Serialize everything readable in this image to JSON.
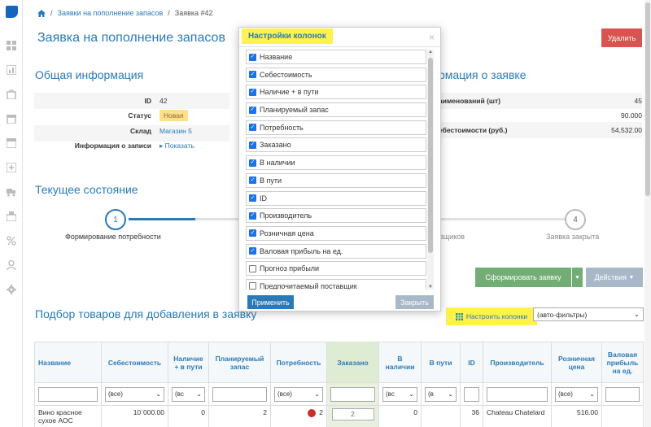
{
  "breadcrumb": {
    "items": [
      "Заявки на пополнение запасов",
      "Заявка #42"
    ]
  },
  "page_title": "Заявка на пополнение запасов",
  "delete_button": "Удалить",
  "general_info": {
    "title": "Общая информация",
    "rows": [
      {
        "label": "ID",
        "value": "42"
      },
      {
        "label": "Статус",
        "value": "Новая"
      },
      {
        "label": "Склад",
        "value": "Магазин 5"
      },
      {
        "label": "Информация о записи",
        "value": "Показать"
      }
    ]
  },
  "order_info": {
    "title": "рмация о заявке",
    "rows": [
      {
        "label": "аименований (шт)",
        "value": "45"
      },
      {
        "label": "",
        "value": "90.000"
      },
      {
        "label": "ебестоимости (руб.)",
        "value": "54,532.00"
      }
    ]
  },
  "current_state": {
    "title": "Текущее состояние",
    "steps": [
      {
        "num": "1",
        "label": "Формирование потребности"
      },
      {
        "num": "4",
        "label": "Заявка закрыта"
      }
    ],
    "partial_label": "вщиков"
  },
  "actions": {
    "form_order": "Сформировать заявку",
    "actions": "Действия"
  },
  "selection": {
    "title": "Подбор товаров для добавления в заявку",
    "configure_columns": "Настроить колонки",
    "filter_select": "(авто-фильтры)"
  },
  "table": {
    "headers": [
      "Название",
      "Себестоимость",
      "Наличие + в пути",
      "Планируемый запас",
      "Потребность",
      "Заказано",
      "В наличии",
      "В пути",
      "ID",
      "Производитель",
      "Розничная цена",
      "Валовая прибыль на ед."
    ],
    "filters": {
      "all_1": "(все)",
      "all_2": "(вс",
      "all_3": "(вс",
      "all_4": "(все)",
      "all_5": "(вс",
      "all_6": "(в",
      "all_7": "(все)"
    },
    "row": {
      "name": "Вино красное сухое АОС",
      "cost": "10`000.00",
      "stock_transit": "0",
      "planned": "2",
      "need": "2",
      "ordered": "2",
      "in_stock": "0",
      "in_transit": "",
      "id": "36",
      "manufacturer": "Chateau Chatelard",
      "retail": "516.00",
      "margin": ""
    }
  },
  "modal": {
    "title": "Настройки колонок",
    "items": [
      {
        "label": "Название",
        "checked": true
      },
      {
        "label": "Себестоимость",
        "checked": true
      },
      {
        "label": "Наличие + в пути",
        "checked": true
      },
      {
        "label": "Планируемый запас",
        "checked": true
      },
      {
        "label": "Потребность",
        "checked": true
      },
      {
        "label": "Заказано",
        "checked": true
      },
      {
        "label": "В наличии",
        "checked": true
      },
      {
        "label": "В пути",
        "checked": true
      },
      {
        "label": "ID",
        "checked": true
      },
      {
        "label": "Производитель",
        "checked": true
      },
      {
        "label": "Розничная цена",
        "checked": true
      },
      {
        "label": "Валовая прибыль на ед.",
        "checked": true
      },
      {
        "label": "Прогноз прибыли",
        "checked": false
      },
      {
        "label": "Предпочитаемый поставщик",
        "checked": false
      }
    ],
    "apply": "Применить",
    "close": "Закрыть"
  },
  "colors": {
    "accent": "#2a7ab8",
    "danger": "#d9534f",
    "success": "#72ad75",
    "highlight": "#fff24a"
  }
}
